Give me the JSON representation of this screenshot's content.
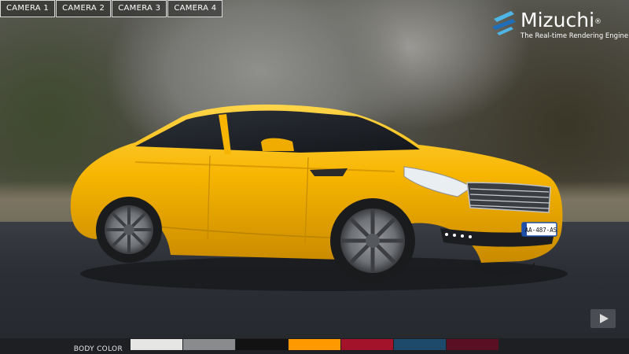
{
  "cameras": [
    "CAMERA 1",
    "CAMERA 2",
    "CAMERA 3",
    "CAMERA 4"
  ],
  "logo": {
    "name": "Mizuchi",
    "registered": "®",
    "tagline": "The Real-time Rendering Engine",
    "colors": [
      "#4fb4e6",
      "#1f6fb8"
    ]
  },
  "car": {
    "body_color": "#f7b500",
    "license_plate": "AA-487-AS"
  },
  "play_button": {
    "icon": "play-icon"
  },
  "body_color_bar": {
    "label": "BODY COLOR",
    "swatches": [
      "#e6e6e4",
      "#8a8b8d",
      "#121212",
      "#ff9900",
      "#a3142a",
      "#1d4a6a",
      "#5a0f22"
    ],
    "selected_index": 3
  }
}
